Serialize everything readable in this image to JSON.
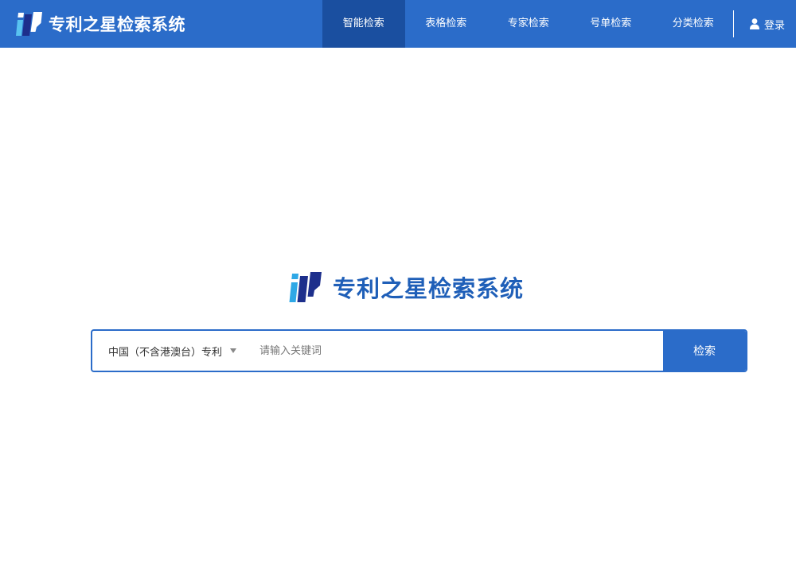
{
  "header": {
    "brand_title": "专利之星检索系统",
    "nav": [
      {
        "label": "智能检索",
        "active": true
      },
      {
        "label": "表格检索",
        "active": false
      },
      {
        "label": "专家检索",
        "active": false
      },
      {
        "label": "号单检索",
        "active": false
      },
      {
        "label": "分类检索",
        "active": false
      }
    ],
    "login_label": "登录",
    "login_icon": "user-icon"
  },
  "hero": {
    "title": "专利之星检索系统",
    "logo_icon": "patent-star-logo"
  },
  "search": {
    "scope_selected": "中国（不含港澳台）专利",
    "scope_icon": "caret-down-icon",
    "keyword_value": "",
    "keyword_placeholder": "请输入关键词",
    "button_label": "检索"
  },
  "colors": {
    "primary": "#2b6cc9",
    "nav_active": "#1a4fa0",
    "hero_title": "#1f5fb8",
    "logo_light": "#2ea8e6",
    "logo_dark": "#1d2f8c"
  }
}
